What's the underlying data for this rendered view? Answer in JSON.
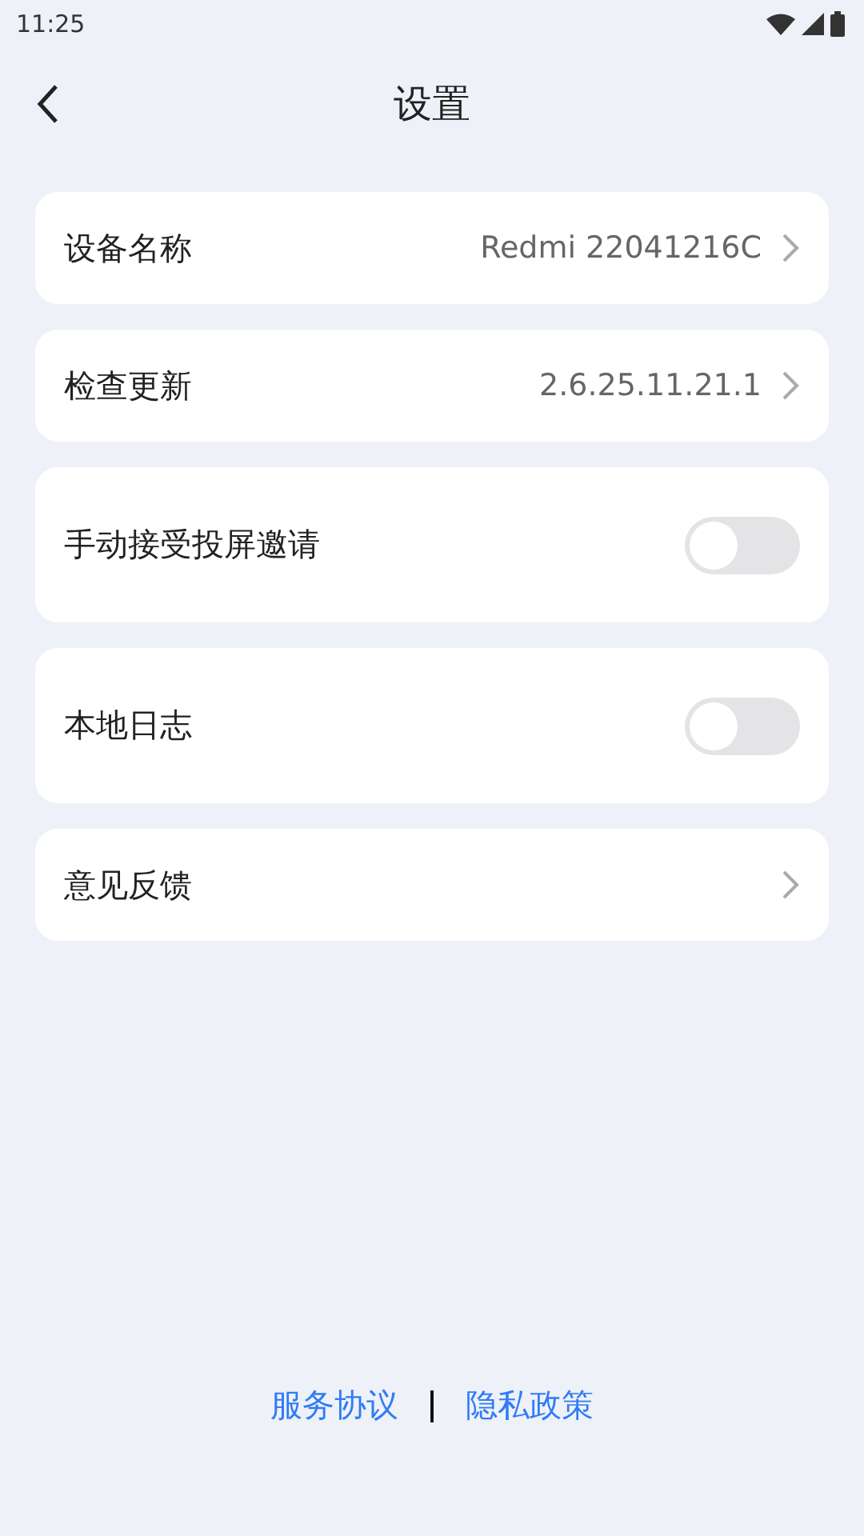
{
  "status_bar": {
    "time": "11:25"
  },
  "header": {
    "title": "设置"
  },
  "rows": [
    {
      "kind": "link",
      "label": "设备名称",
      "value": "Redmi 22041216C"
    },
    {
      "kind": "link",
      "label": "检查更新",
      "value": "2.6.25.11.21.1"
    },
    {
      "kind": "toggle",
      "label": "手动接受投屏邀请",
      "on": false
    },
    {
      "kind": "toggle",
      "label": "本地日志",
      "on": false
    },
    {
      "kind": "link",
      "label": "意见反馈"
    }
  ],
  "footer_links": [
    "服务协议",
    "隐私政策"
  ]
}
